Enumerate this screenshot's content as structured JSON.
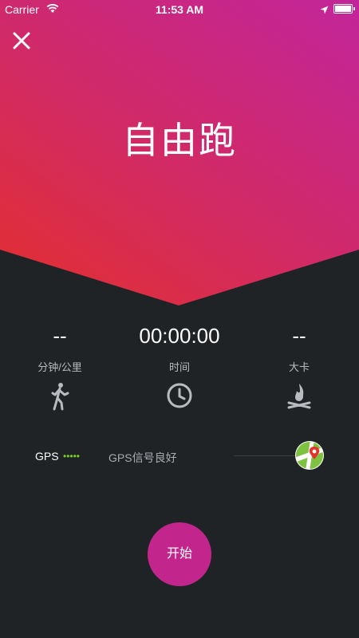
{
  "status_bar": {
    "carrier": "Carrier",
    "time": "11:53 AM",
    "icons": [
      "wifi-icon",
      "location-arrow-icon",
      "battery-icon"
    ]
  },
  "header": {
    "close_icon": "close-icon",
    "title": "自由跑"
  },
  "stats": [
    {
      "value": "--",
      "label": "分钟/公里",
      "icon": "walking-person-icon"
    },
    {
      "value": "00:00:00",
      "label": "时间",
      "icon": "clock-icon"
    },
    {
      "value": "--",
      "label": "大卡",
      "icon": "campfire-icon"
    }
  ],
  "gps": {
    "label": "GPS",
    "signal_dots": "•••••",
    "status": "GPS信号良好",
    "map_icon": "map-pin-icon"
  },
  "start_button": {
    "label": "开始"
  },
  "colors": {
    "hero_gradient_start": "#e3302d",
    "hero_gradient_end": "#c2259b",
    "background": "#1f2326",
    "accent": "#c2268c",
    "signal_green": "#7ad11a"
  }
}
